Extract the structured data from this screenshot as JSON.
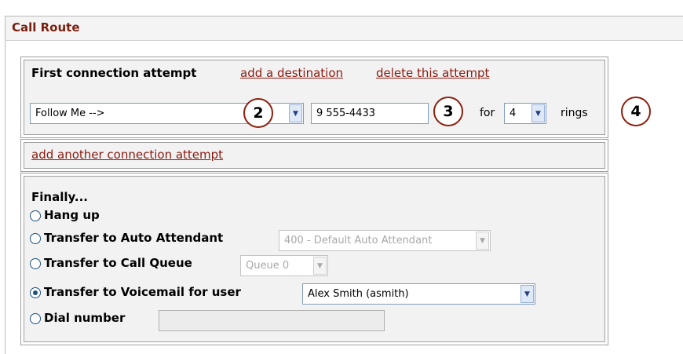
{
  "panel": {
    "title": "Call Route"
  },
  "attempt": {
    "label": "First connection attempt",
    "add_destination_link": "add a destination",
    "delete_attempt_link": "delete this attempt",
    "destination_select": "Follow Me -->",
    "number_value": "9 555-4433",
    "for_label": "for",
    "rings_select": "4",
    "rings_label": "rings"
  },
  "add_attempt_link": "add another connection attempt",
  "finally": {
    "label": "Finally...",
    "options": [
      {
        "label": "Hang up",
        "checked": false
      },
      {
        "label": "Transfer to Auto Attendant",
        "checked": false,
        "select": "400 - Default Auto Attendant"
      },
      {
        "label": "Transfer to Call Queue",
        "checked": false,
        "select": "Queue 0"
      },
      {
        "label": "Transfer to Voicemail for user",
        "checked": true,
        "select": "Alex Smith (asmith)"
      },
      {
        "label": "Dial number",
        "checked": false,
        "input": ""
      }
    ]
  },
  "callouts": [
    "2",
    "3",
    "4"
  ],
  "icons": {
    "dropdown": "chevron-down-icon",
    "radio": "radio-button"
  },
  "colors": {
    "link": "#8b1a10",
    "title": "#7a1f0e",
    "callout_border": "#8b2010"
  }
}
